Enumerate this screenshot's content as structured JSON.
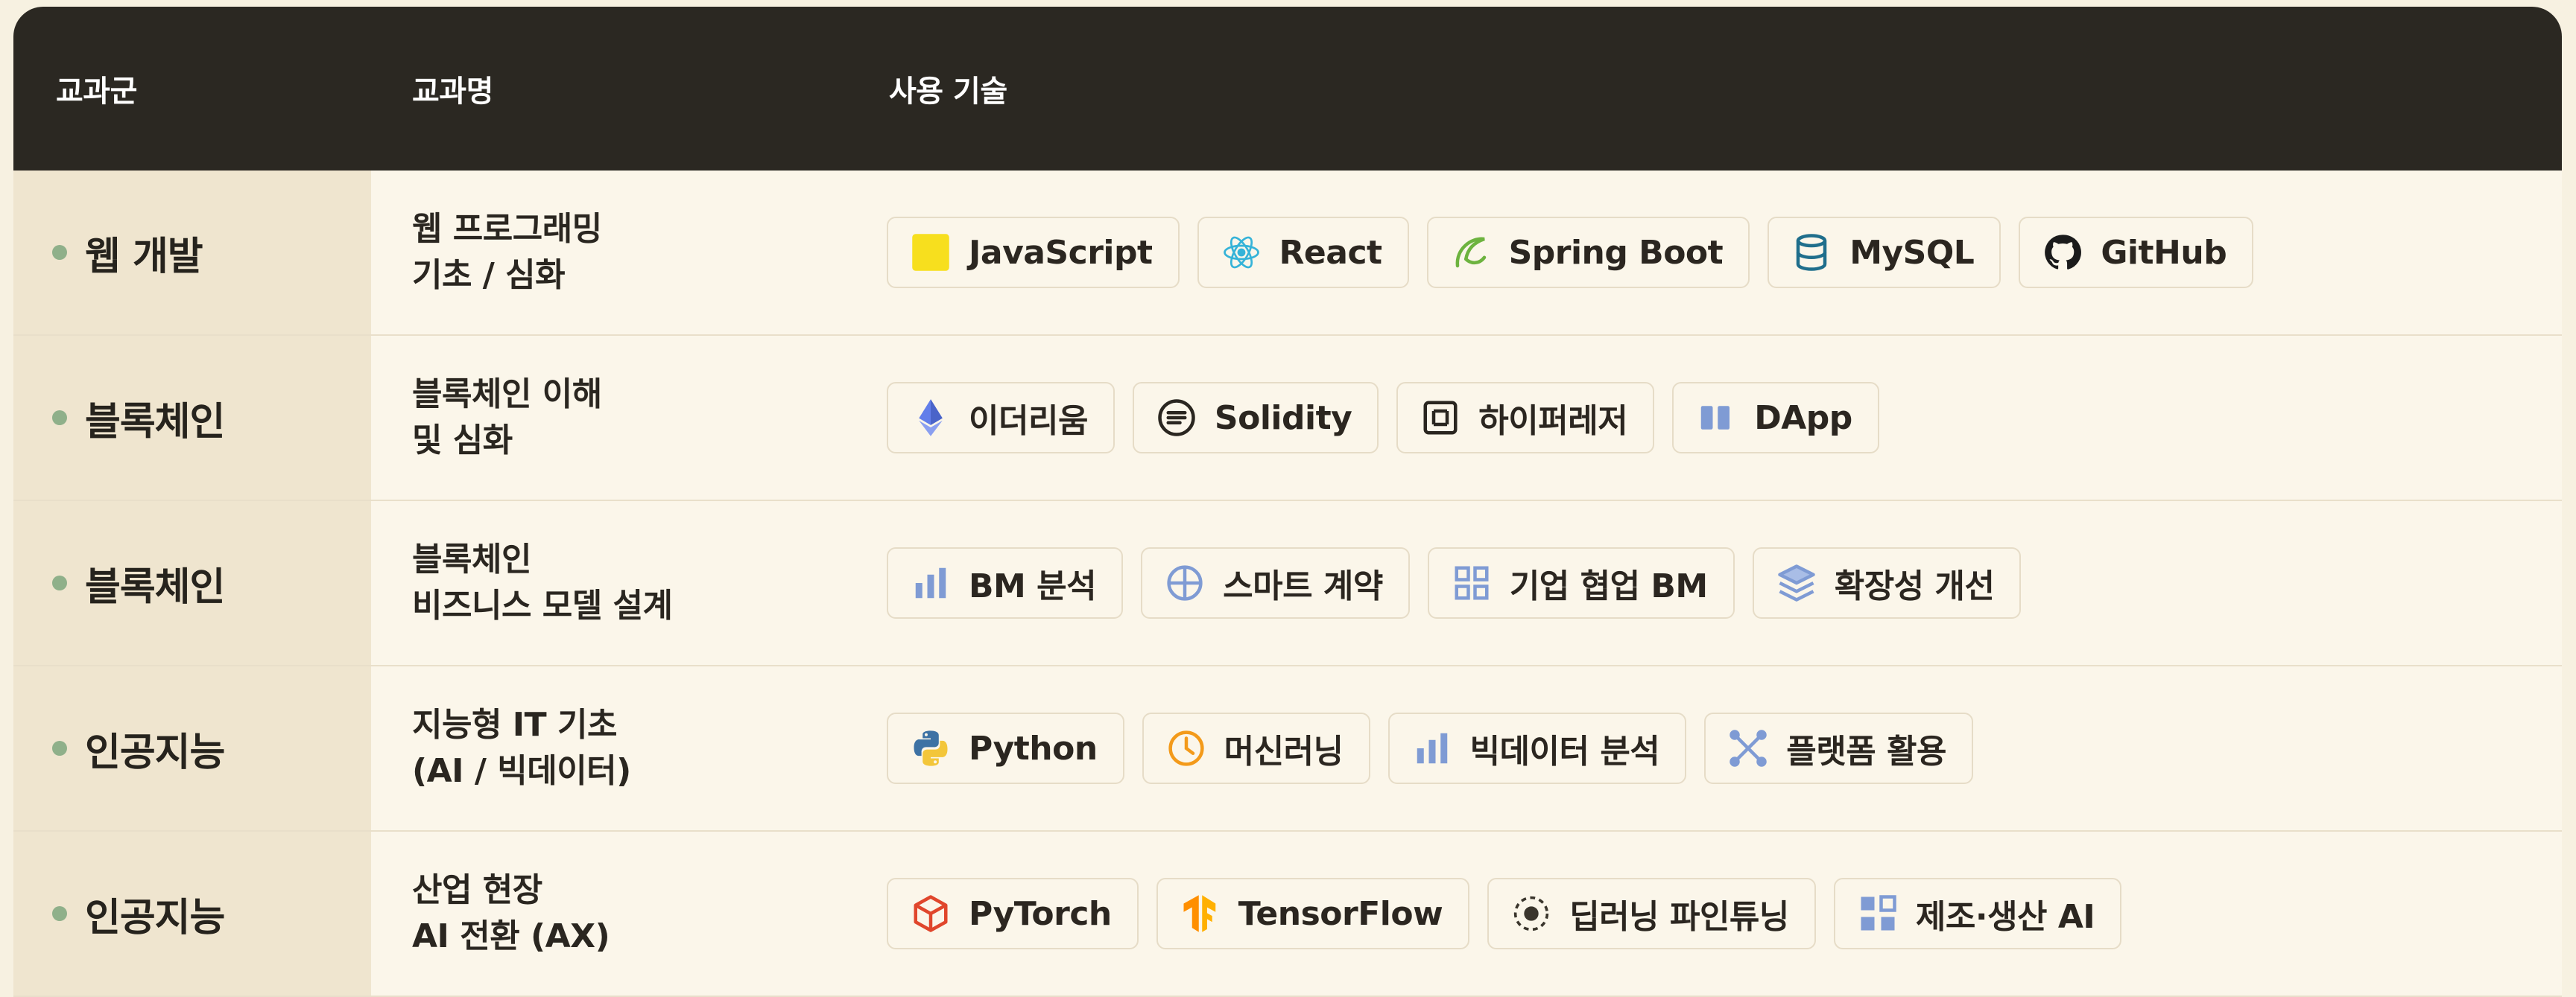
{
  "header": {
    "col_group": "교과군",
    "col_course": "교과명",
    "col_tech": "사용 기술"
  },
  "colors": {
    "header_bg": "#2b2822",
    "group_bg": "#efe5cf",
    "row_bg": "#fbf6ea",
    "dot": "#8fb08a"
  },
  "rows": [
    {
      "group": "웹 개발",
      "course_line1": "웹 프로그래밍",
      "course_line2": "기초 / 심화",
      "techs": [
        {
          "label": "JavaScript",
          "icon": "javascript-icon"
        },
        {
          "label": "React",
          "icon": "react-icon"
        },
        {
          "label": "Spring Boot",
          "icon": "spring-icon"
        },
        {
          "label": "MySQL",
          "icon": "database-icon"
        },
        {
          "label": "GitHub",
          "icon": "github-icon"
        }
      ]
    },
    {
      "group": "블록체인",
      "course_line1": "블록체인 이해",
      "course_line2": "및 심화",
      "techs": [
        {
          "label": "이더리움",
          "icon": "ethereum-icon"
        },
        {
          "label": "Solidity",
          "icon": "solidity-icon"
        },
        {
          "label": "하이퍼레저",
          "icon": "hyperledger-icon"
        },
        {
          "label": "DApp",
          "icon": "dapp-icon"
        }
      ]
    },
    {
      "group": "블록체인",
      "course_line1": "블록체인",
      "course_line2": "비즈니스 모델 설계",
      "techs": [
        {
          "label": "BM 분석",
          "icon": "bar-chart-icon"
        },
        {
          "label": "스마트 계약",
          "icon": "crosshair-circle-icon"
        },
        {
          "label": "기업 협업 BM",
          "icon": "grid-icon"
        },
        {
          "label": "확장성 개선",
          "icon": "layers-icon"
        }
      ]
    },
    {
      "group": "인공지능",
      "course_line1": "지능형 IT 기초",
      "course_line2": "(AI / 빅데이터)",
      "techs": [
        {
          "label": "Python",
          "icon": "python-icon"
        },
        {
          "label": "머신러닝",
          "icon": "clock-icon"
        },
        {
          "label": "빅데이터 분석",
          "icon": "bar-chart-icon"
        },
        {
          "label": "플랫폼 활용",
          "icon": "nodes-icon"
        }
      ]
    },
    {
      "group": "인공지능",
      "course_line1": "산업 현장",
      "course_line2": "AI 전환 (AX)",
      "techs": [
        {
          "label": "PyTorch",
          "icon": "pytorch-icon"
        },
        {
          "label": "TensorFlow",
          "icon": "tensorflow-icon"
        },
        {
          "label": "딥러닝 파인튜닝",
          "icon": "target-dot-icon"
        },
        {
          "label": "제조·생산 AI",
          "icon": "blocks-icon"
        }
      ]
    }
  ]
}
